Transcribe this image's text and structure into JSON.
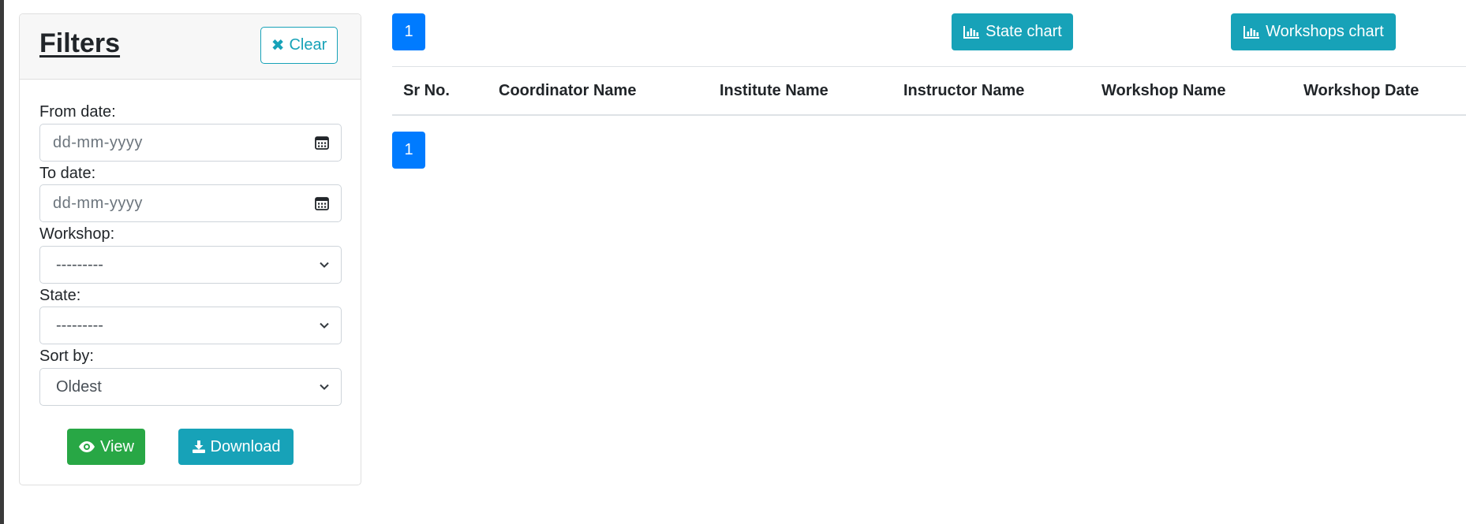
{
  "filters": {
    "title": "Filters",
    "clear_label": "Clear",
    "from_date": {
      "label": "From date:",
      "placeholder": "dd-mm-yyyy"
    },
    "to_date": {
      "label": "To date:",
      "placeholder": "dd-mm-yyyy"
    },
    "workshop": {
      "label": "Workshop:",
      "value": "---------"
    },
    "state": {
      "label": "State:",
      "value": "---------"
    },
    "sort_by": {
      "label": "Sort by:",
      "value": "Oldest"
    },
    "view_label": "View",
    "download_label": "Download"
  },
  "pagination": {
    "top_page": "1",
    "bottom_page": "1"
  },
  "charts": {
    "state_chart_label": "State chart",
    "workshops_chart_label": "Workshops chart"
  },
  "table": {
    "headers": [
      "Sr No.",
      "Coordinator Name",
      "Institute Name",
      "Instructor Name",
      "Workshop Name",
      "Workshop Date"
    ]
  },
  "colors": {
    "primary": "#007bff",
    "info": "#17a2b8",
    "success": "#28a745"
  }
}
